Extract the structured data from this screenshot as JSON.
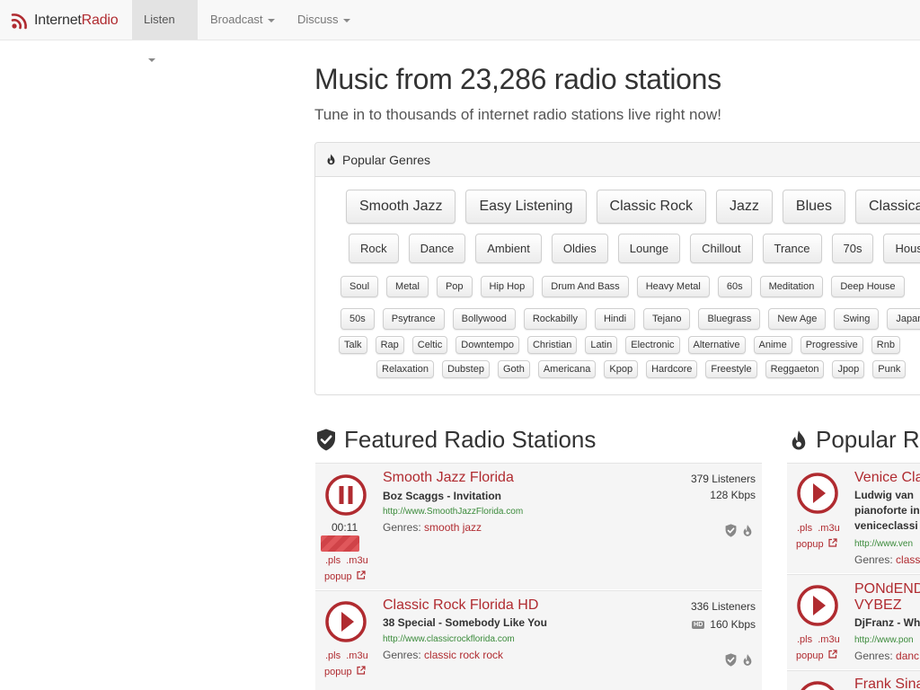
{
  "brand": {
    "part1": "Internet",
    "part2": "Radio",
    "accent": "#b02b30"
  },
  "nav": {
    "items": [
      {
        "label": "Listen",
        "active": true
      },
      {
        "label": "Broadcast",
        "active": false
      },
      {
        "label": "Discuss",
        "active": false
      }
    ]
  },
  "hero": {
    "title": "Music from 23,286 radio stations",
    "subtitle": "Tune in to thousands of internet radio stations live right now!"
  },
  "genres": {
    "heading": "Popular Genres",
    "rows": [
      [
        "Smooth Jazz",
        "Easy Listening",
        "Classic Rock",
        "Jazz",
        "Blues",
        "Classical"
      ],
      [
        "Rock",
        "Dance",
        "Ambient",
        "Oldies",
        "Lounge",
        "Chillout",
        "Trance",
        "70s",
        "House"
      ],
      [
        "Soul",
        "Metal",
        "Pop",
        "Hip Hop",
        "Drum And Bass",
        "Heavy Metal",
        "60s",
        "Meditation",
        "Deep House"
      ],
      [
        "50s",
        "Psytrance",
        "Bollywood",
        "Rockabilly",
        "Hindi",
        "Tejano",
        "Bluegrass",
        "New Age",
        "Swing",
        "Japanese"
      ],
      [
        "Talk",
        "Rap",
        "Celtic",
        "Downtempo",
        "Christian",
        "Latin",
        "Electronic",
        "Alternative",
        "Anime",
        "Progressive",
        "Rnb"
      ],
      [
        "Relaxation",
        "Dubstep",
        "Goth",
        "Americana",
        "Kpop",
        "Hardcore",
        "Freestyle",
        "Reggaeton",
        "Jpop",
        "Punk"
      ]
    ]
  },
  "featured": {
    "heading": "Featured Radio Stations",
    "stations": [
      {
        "name": "Smooth Jazz Florida",
        "song": "Boz Scaggs - Invitation",
        "url": "http://www.SmoothJazzFlorida.com",
        "genres_label": "Genres:",
        "genres": "smooth jazz",
        "listeners": "379 Listeners",
        "bitrate": "128 Kbps",
        "playing": true,
        "timer": "00:11",
        "volume": 0.7,
        "pls": ".pls",
        "m3u": ".m3u",
        "popup": "popup"
      },
      {
        "name": "Classic Rock Florida HD",
        "song": "38 Special - Somebody Like You",
        "url": "http://www.classicrockflorida.com",
        "genres_label": "Genres:",
        "genres": "classic rock rock",
        "listeners": "336 Listeners",
        "hd": "HD",
        "bitrate": "160 Kbps",
        "playing": false,
        "pls": ".pls",
        "m3u": ".m3u",
        "popup": "popup"
      }
    ]
  },
  "popular": {
    "heading": "Popular R",
    "stations": [
      {
        "name": "Venice Cla",
        "song_lines": [
          "Ludwig van",
          "pianoforte in",
          "veniceclassi"
        ],
        "url": "http://www.ven",
        "genres_label": "Genres:",
        "genres": "class",
        "pls": ".pls",
        "m3u": ".m3u",
        "popup": "popup"
      },
      {
        "name_lines": [
          "PONdEND",
          "VYBEZ"
        ],
        "song_lines": [
          "DjFranz - Wh"
        ],
        "url": "http://www.pon",
        "genres_label": "Genres:",
        "genres": "danc",
        "pls": ".pls",
        "m3u": ".m3u",
        "popup": "popup"
      },
      {
        "name": "Frank Sina"
      }
    ]
  },
  "icons": {
    "brand": "radio-waves-icon",
    "genres": "fire-icon",
    "featured": "shield-check-icon",
    "popular": "fire-icon",
    "play": "play-icon",
    "pause": "pause-icon",
    "popup": "external-link-icon"
  }
}
